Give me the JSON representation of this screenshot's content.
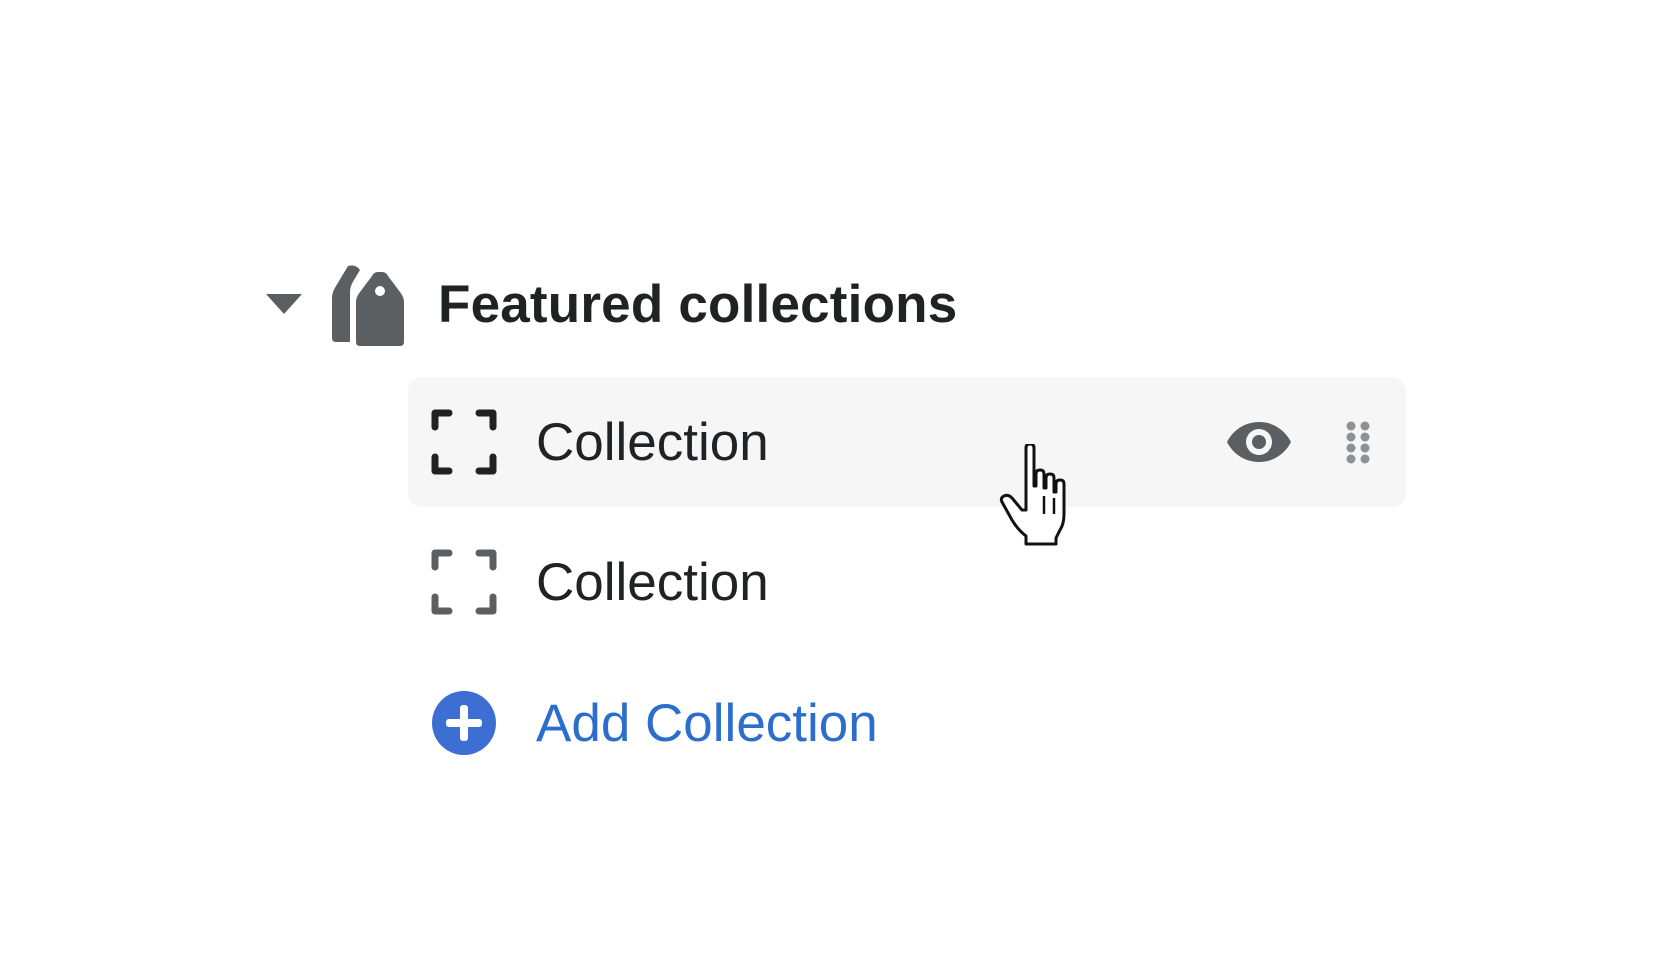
{
  "section": {
    "title": "Featured collections",
    "expanded": true,
    "caret_icon": "caret-down-icon",
    "section_icon": "tags-icon"
  },
  "blocks": [
    {
      "label": "Collection",
      "icon": "block-placeholder-icon",
      "hovered": true,
      "actions": [
        "eye-icon",
        "drag-handle-icon"
      ]
    },
    {
      "label": "Collection",
      "icon": "block-placeholder-icon",
      "hovered": false
    }
  ],
  "add_block": {
    "label": "Add Collection",
    "icon": "plus-circle-icon"
  },
  "colors": {
    "title_text": "#202223",
    "icon_gray": "#5c5f62",
    "hover_bg": "#f6f6f7",
    "link_blue": "#2c6ecb",
    "add_icon_blue": "#3d6fd2"
  }
}
